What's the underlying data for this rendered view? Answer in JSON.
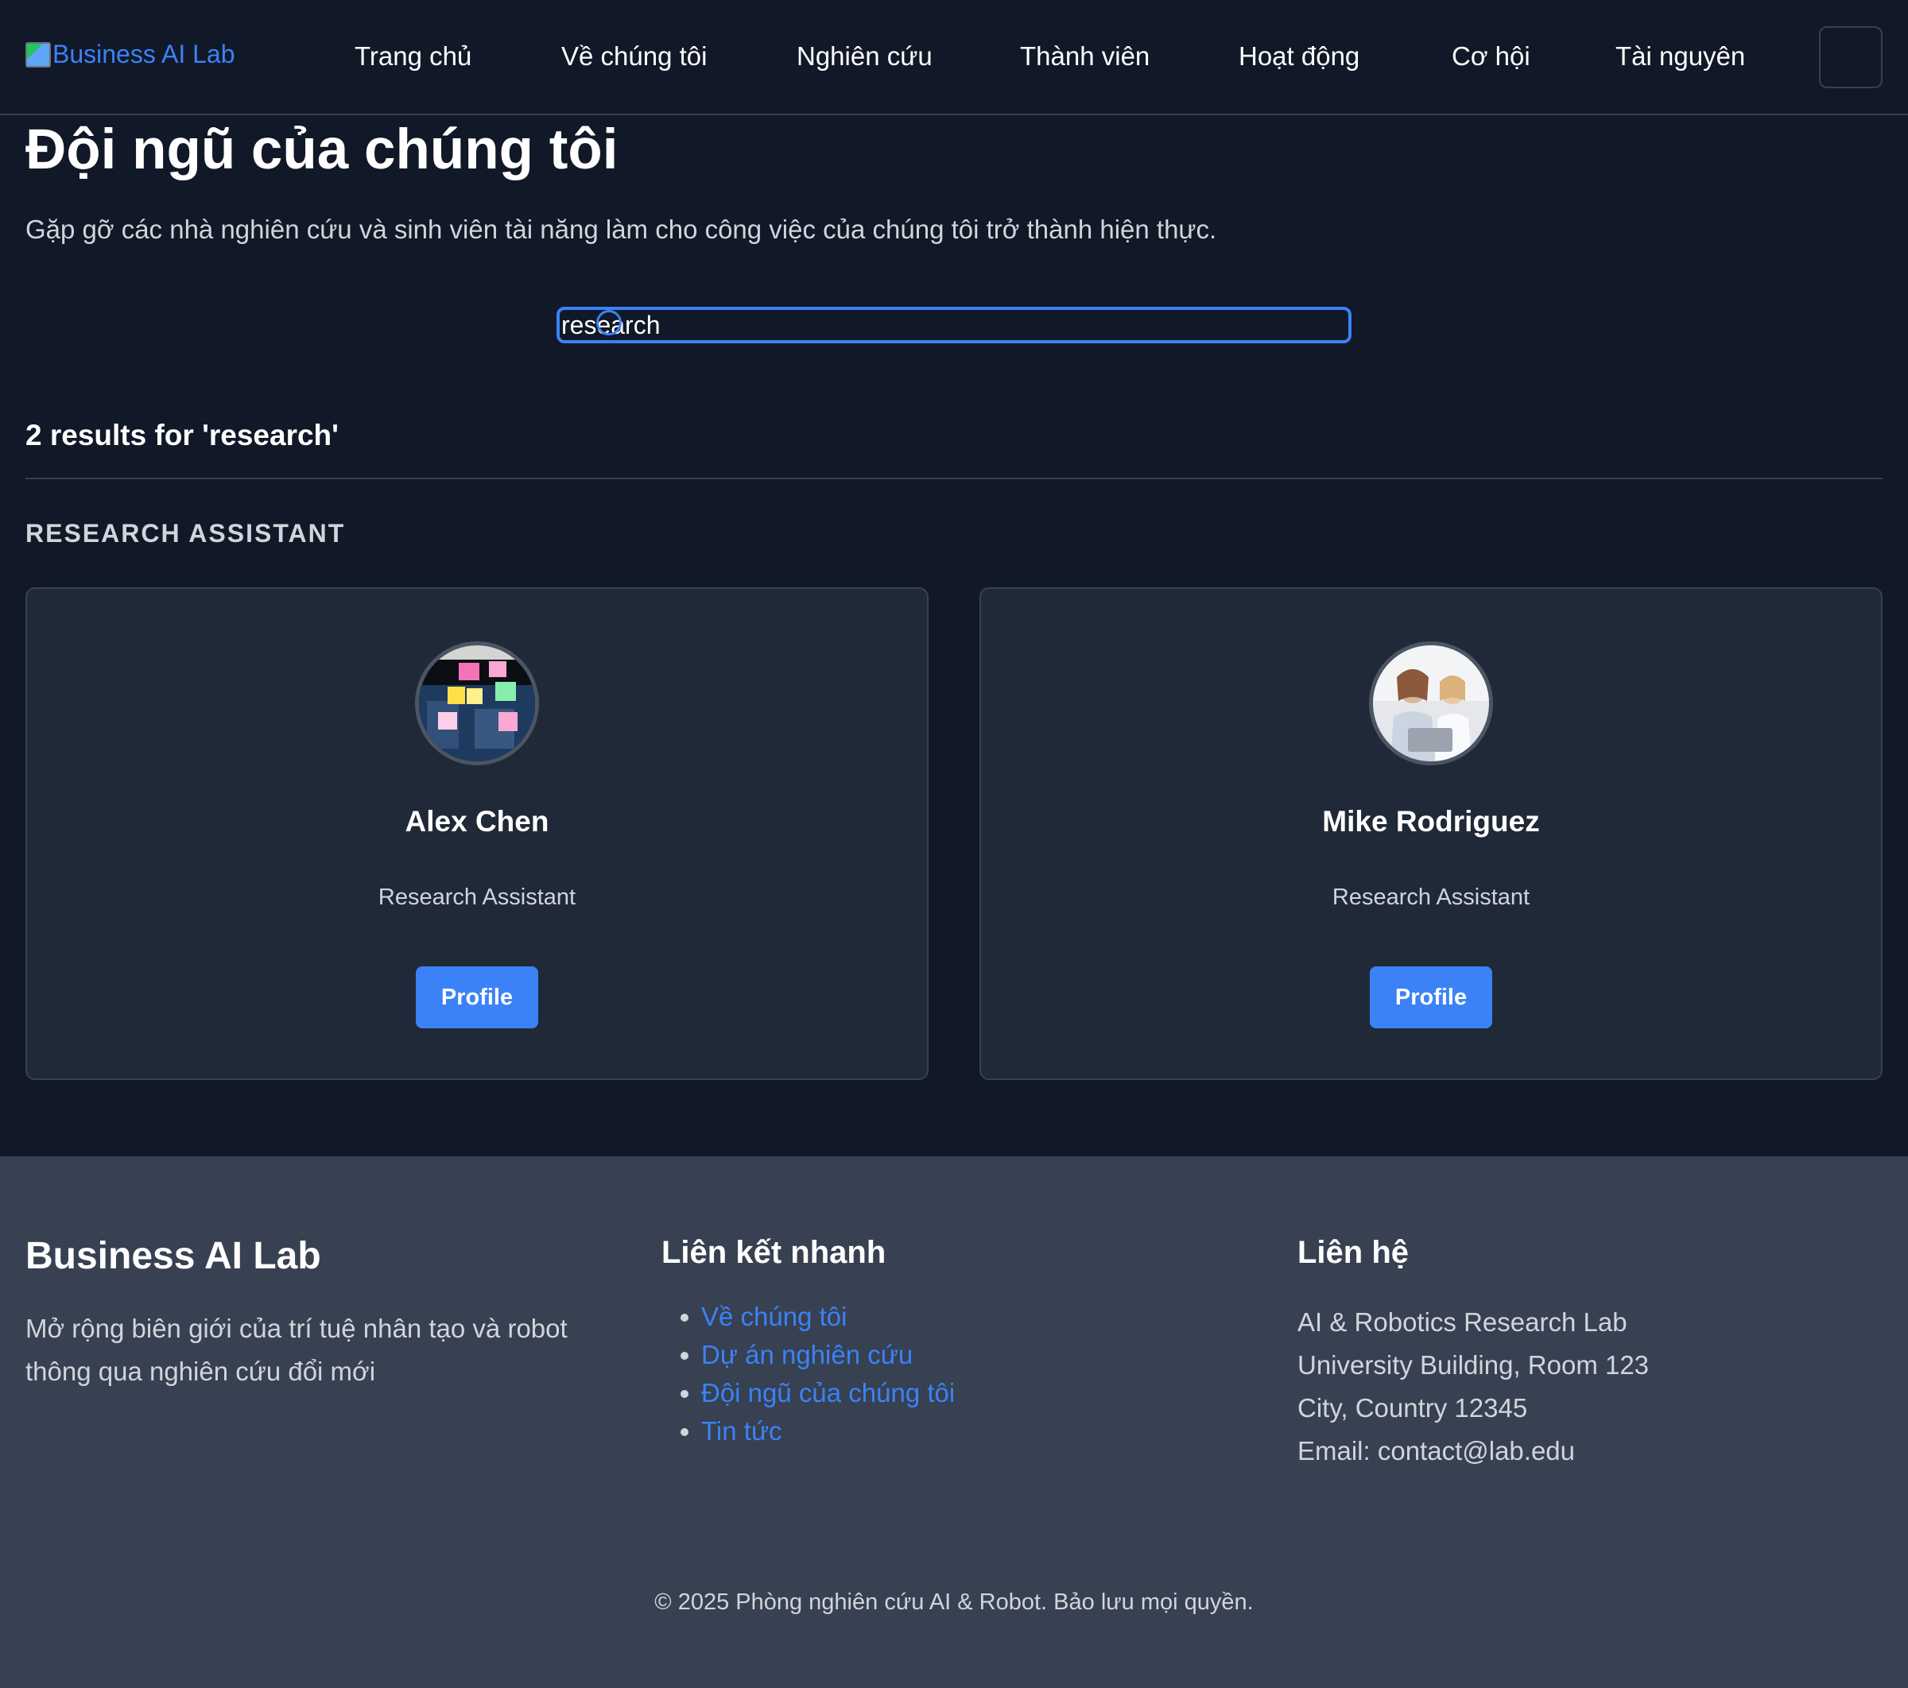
{
  "nav": {
    "logo_text": "Business AI Lab",
    "items": [
      {
        "label": "Trang chủ"
      },
      {
        "label": "Về chúng tôi"
      },
      {
        "label": "Nghiên cứu"
      },
      {
        "label": "Thành viên"
      },
      {
        "label": "Hoạt động"
      },
      {
        "label": "Cơ hội"
      },
      {
        "label": "Tài nguyên"
      }
    ],
    "theme_toggle_icon": "moon-icon"
  },
  "header": {
    "title": "Đội ngũ của chúng tôi",
    "subtitle": "Gặp gỡ các nhà nghiên cứu và sinh viên tài năng làm cho công việc của chúng tôi trở thành hiện thực."
  },
  "search": {
    "value": "research",
    "placeholder": ""
  },
  "results": {
    "count_text": "2 results for 'research'",
    "group_heading": "RESEARCH ASSISTANT",
    "members": [
      {
        "name": "Alex Chen",
        "role": "Research Assistant",
        "button_label": "Profile",
        "avatar_icon": "sticky-notes-photo"
      },
      {
        "name": "Mike Rodriguez",
        "role": "Research Assistant",
        "button_label": "Profile",
        "avatar_icon": "two-women-laptop-photo"
      }
    ]
  },
  "footer": {
    "brand": "Business AI Lab",
    "tagline": "Mở rộng biên giới của trí tuệ nhân tạo và robot thông qua nghiên cứu đổi mới",
    "quick_links_title": "Liên kết nhanh",
    "quick_links": [
      {
        "label": "Về chúng tôi"
      },
      {
        "label": "Dự án nghiên cứu"
      },
      {
        "label": "Đội ngũ của chúng tôi"
      },
      {
        "label": "Tin tức"
      }
    ],
    "contact_title": "Liên hệ",
    "contact_lines": [
      "AI & Robotics Research Lab",
      "University Building, Room 123",
      "City, Country 12345",
      "Email: contact@lab.edu"
    ],
    "copyright": "© 2025 Phòng nghiên cứu AI & Robot. Bảo lưu mọi quyền."
  },
  "colors": {
    "background": "#111827",
    "card": "#1f2937",
    "footer": "#374151",
    "accent": "#3b82f6",
    "link": "#60a5fa"
  }
}
